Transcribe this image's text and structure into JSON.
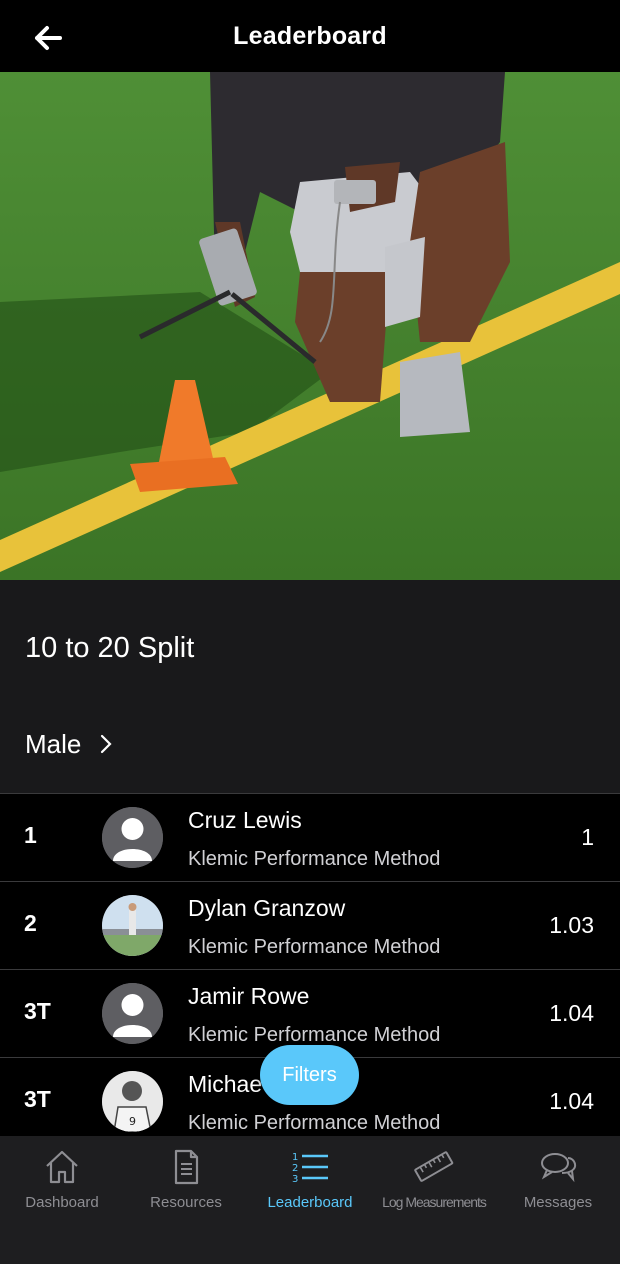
{
  "header": {
    "title": "Leaderboard",
    "back_icon": "back-arrow-icon"
  },
  "hero": {
    "image": "athlete kneeling on turf with timing gate and orange cone"
  },
  "metric": {
    "name": "10 to 20 Split"
  },
  "filter": {
    "gender": "Male"
  },
  "leaderboard": [
    {
      "rank": "1",
      "name": "Cruz Lewis",
      "org": "Klemic Performance Method",
      "value": "1",
      "avatar": "default"
    },
    {
      "rank": "2",
      "name": "Dylan Granzow",
      "org": "Klemic Performance Method",
      "value": "1.03",
      "avatar": "photo"
    },
    {
      "rank": "3T",
      "name": "Jamir Rowe",
      "org": "Klemic Performance Method",
      "value": "1.04",
      "avatar": "default"
    },
    {
      "rank": "3T",
      "name": "Michae",
      "org": "Klemic Performance Method",
      "value": "1.04",
      "avatar": "photo-bw"
    }
  ],
  "filters_button": {
    "label": "Filters"
  },
  "tabs": [
    {
      "label": "Dashboard",
      "icon": "home-icon",
      "active": false
    },
    {
      "label": "Resources",
      "icon": "document-icon",
      "active": false
    },
    {
      "label": "Leaderboard",
      "icon": "ranked-list-icon",
      "active": true
    },
    {
      "label": "Log Measurements",
      "icon": "ruler-icon",
      "active": false
    },
    {
      "label": "Messages",
      "icon": "chat-bubbles-icon",
      "active": false
    }
  ],
  "colors": {
    "accent": "#5ac8fa",
    "background": "#000000",
    "section": "#19191b",
    "tabbar": "#1e1e20"
  }
}
